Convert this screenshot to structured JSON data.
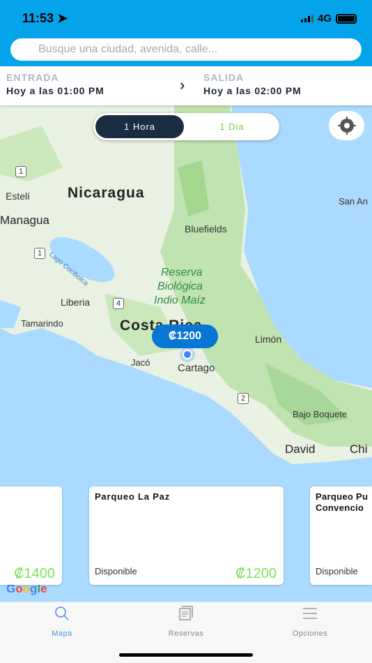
{
  "status_bar": {
    "time": "11:53",
    "network": "4G",
    "icons": [
      "location-arrow-icon",
      "signal-icon",
      "battery-icon"
    ]
  },
  "search": {
    "placeholder": "Busque una ciudad, avenida, calle..."
  },
  "times": {
    "entry_label": "ENTRADA",
    "entry_value": "Hoy a las 01:00 PM",
    "exit_label": "SALIDA",
    "exit_value": "Hoy a las 02:00 PM"
  },
  "toggle": {
    "options": [
      "1 Hora",
      "1 Dia"
    ],
    "selected": "1 Hora"
  },
  "map": {
    "labels": {
      "esteli": "Estelí",
      "nicaragua": "Nicaragua",
      "managua": "Managua",
      "bluefields": "Bluefields",
      "san_andres": "San An",
      "lago": "Lago Cocibolca",
      "reserva1": "Reserva",
      "reserva2": "Biológica",
      "reserva3": "Indio Maíz",
      "liberia": "Liberia",
      "tamarindo": "Tamarindo",
      "costa_rica": "Costa Rica",
      "limon": "Limón",
      "jaco": "Jacó",
      "cartago": "Cartago",
      "bajo_boquete": "Bajo Boquete",
      "david": "David",
      "chi": "Chi"
    },
    "routes": [
      "1",
      "1",
      "4",
      "2"
    ],
    "pin_price": "₡1200",
    "attribution": "Google"
  },
  "cards": [
    {
      "name": "",
      "status": "",
      "price": "₡1400"
    },
    {
      "name": "Parqueo La Paz",
      "status": "Disponible",
      "price": "₡1200"
    },
    {
      "name": "Parqueo Pu\nConvencio",
      "status": "Disponible",
      "price": ""
    }
  ],
  "tabs": [
    {
      "label": "Mapa",
      "active": true
    },
    {
      "label": "Reservas"
    },
    {
      "label": "Opciones"
    }
  ],
  "colors": {
    "header": "#03a4ea",
    "accent_green": "#6ed24a",
    "toggle_dark": "#1b2d42",
    "active_tab": "#4a90e2",
    "pin": "#0876d4"
  }
}
